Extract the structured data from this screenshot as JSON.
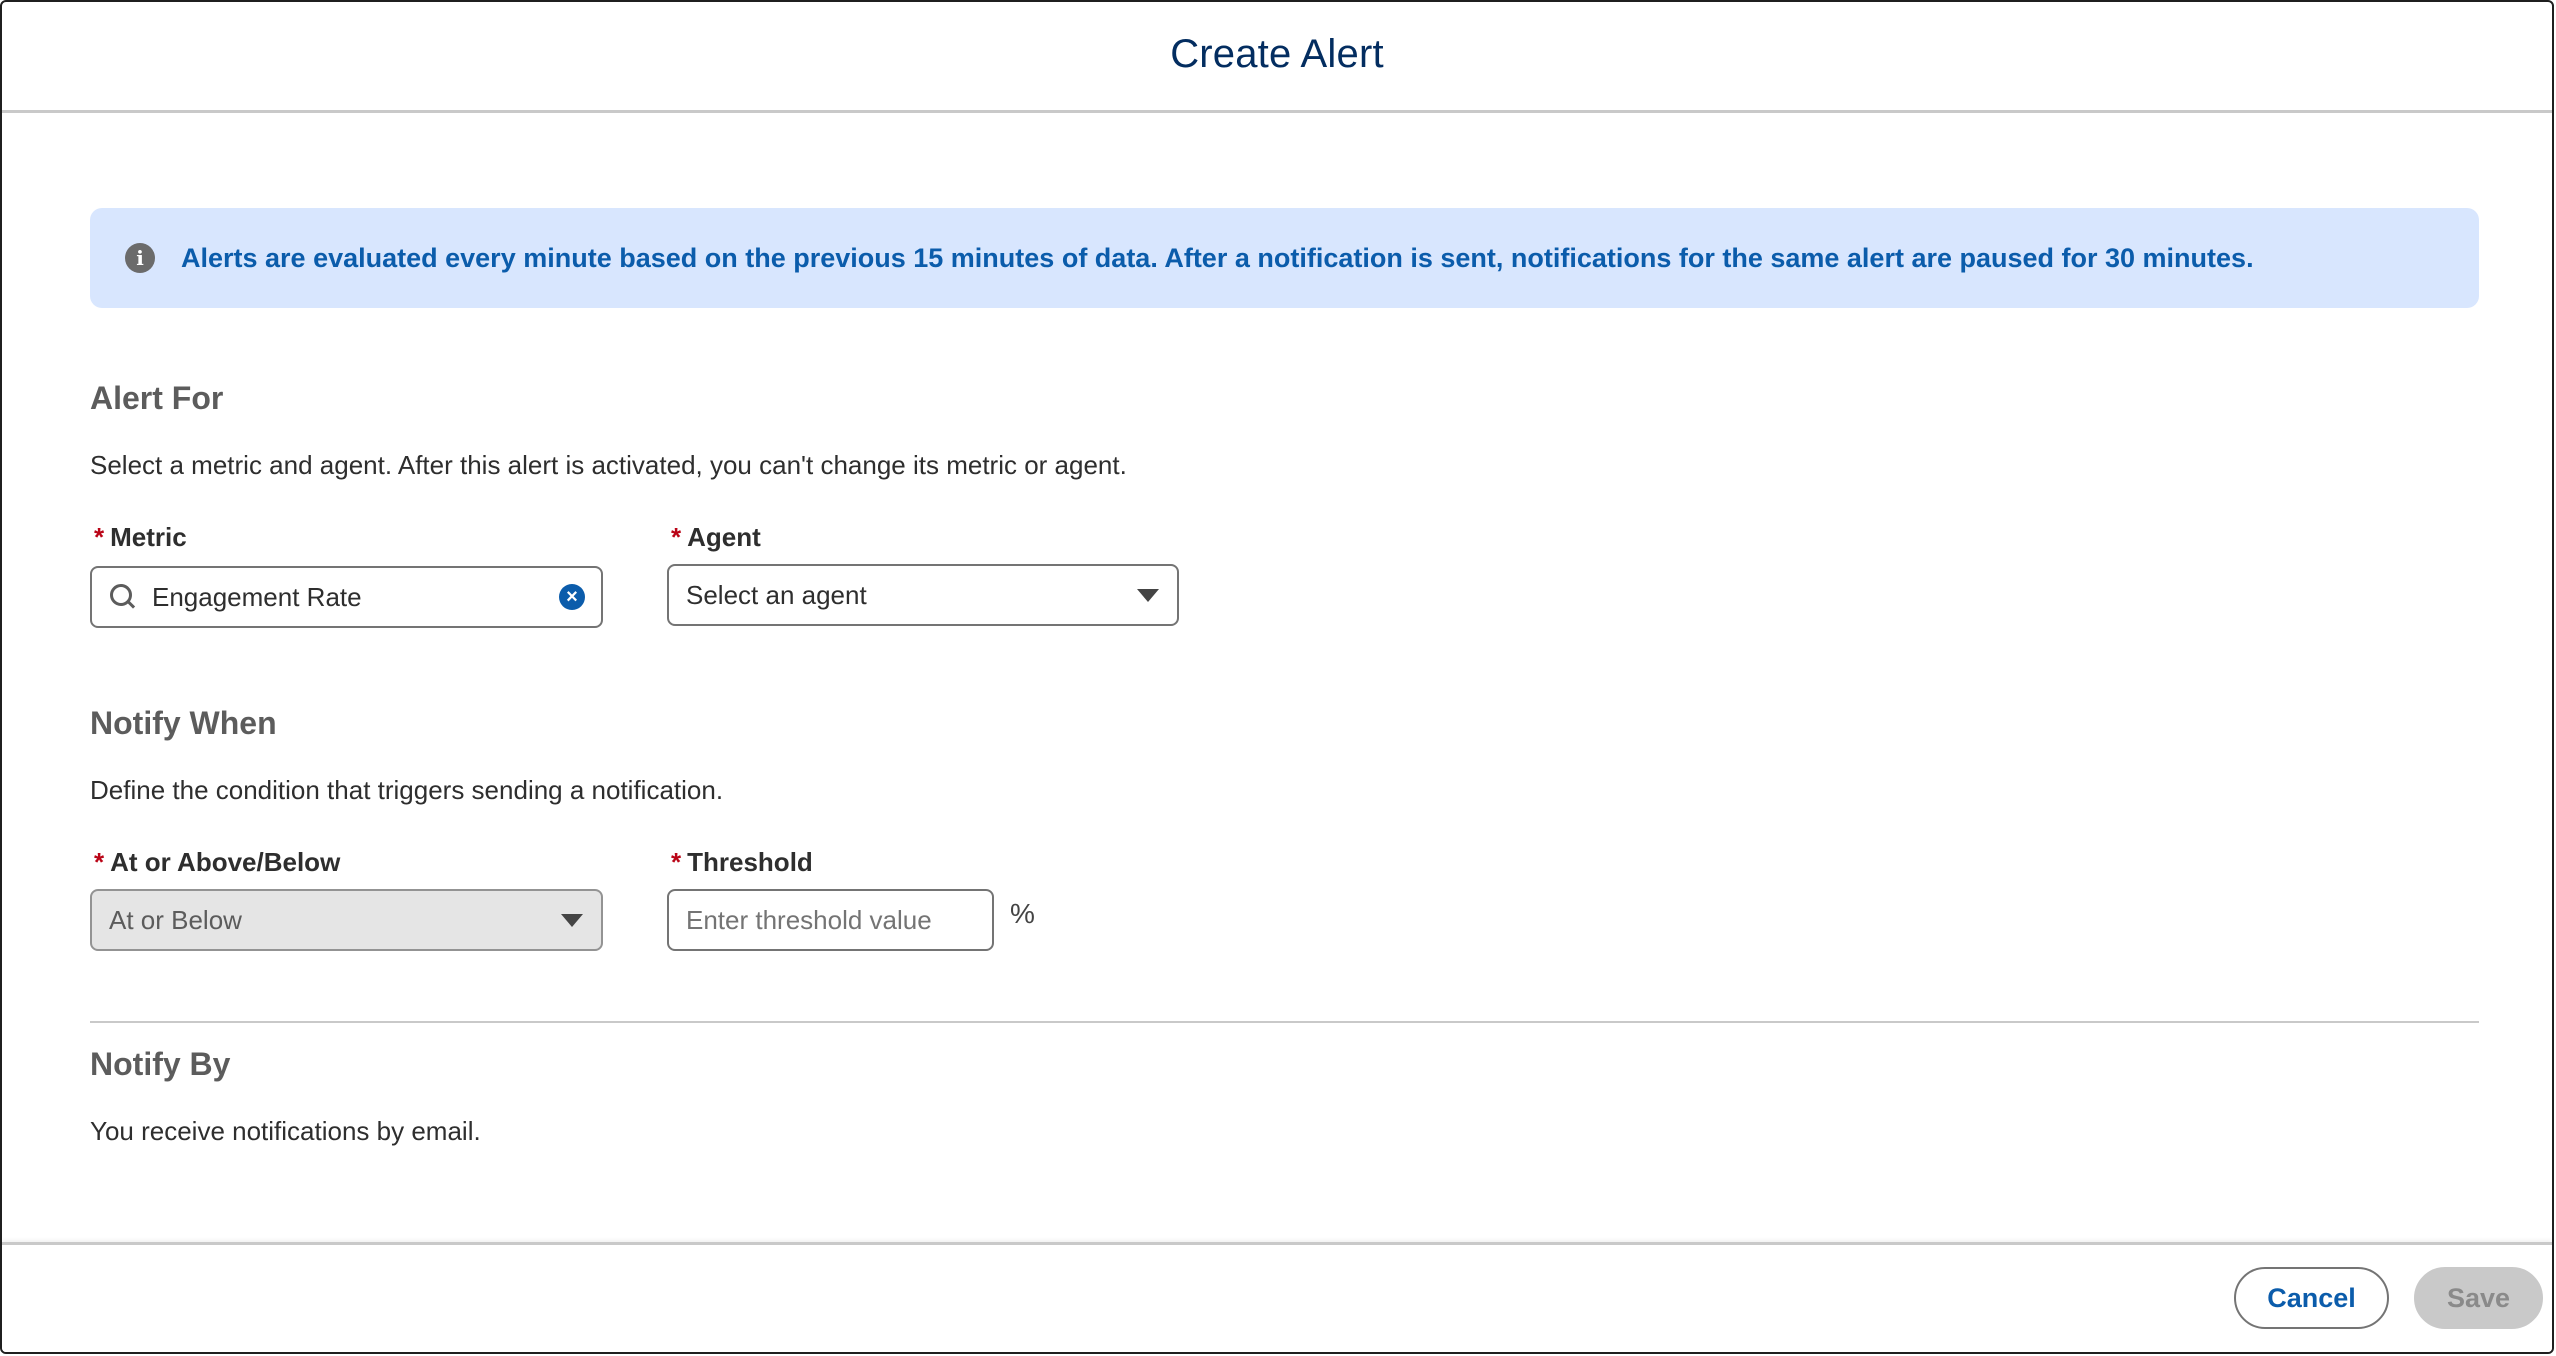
{
  "modal": {
    "title": "Create Alert"
  },
  "banner": {
    "icon": "info-icon",
    "text": "Alerts are evaluated every minute based on the previous 15 minutes of data. After a notification is sent, notifications for the same alert are paused for 30 minutes."
  },
  "alert_for": {
    "title": "Alert For",
    "description": "Select a metric and agent. After this alert is activated, you can't change its metric or agent.",
    "metric": {
      "required": "*",
      "label": "Metric",
      "value": "Engagement Rate",
      "clear_glyph": "×"
    },
    "agent": {
      "required": "*",
      "label": "Agent",
      "value": "Select an agent"
    }
  },
  "notify_when": {
    "title": "Notify When",
    "description": "Define the condition that triggers sending a notification.",
    "comparison": {
      "required": "*",
      "label": "At or Above/Below",
      "value": "At or Below"
    },
    "threshold": {
      "required": "*",
      "label": "Threshold",
      "placeholder": "Enter threshold value",
      "unit": "%"
    }
  },
  "notify_by": {
    "title": "Notify By",
    "description": "You receive notifications by email."
  },
  "footer": {
    "cancel_label": "Cancel",
    "save_label": "Save"
  },
  "colors": {
    "title": "#032d60",
    "banner_bg": "#d8e6fe",
    "banner_text": "#0b5cab",
    "required": "#ba0517",
    "link_blue": "#0b5cab"
  }
}
